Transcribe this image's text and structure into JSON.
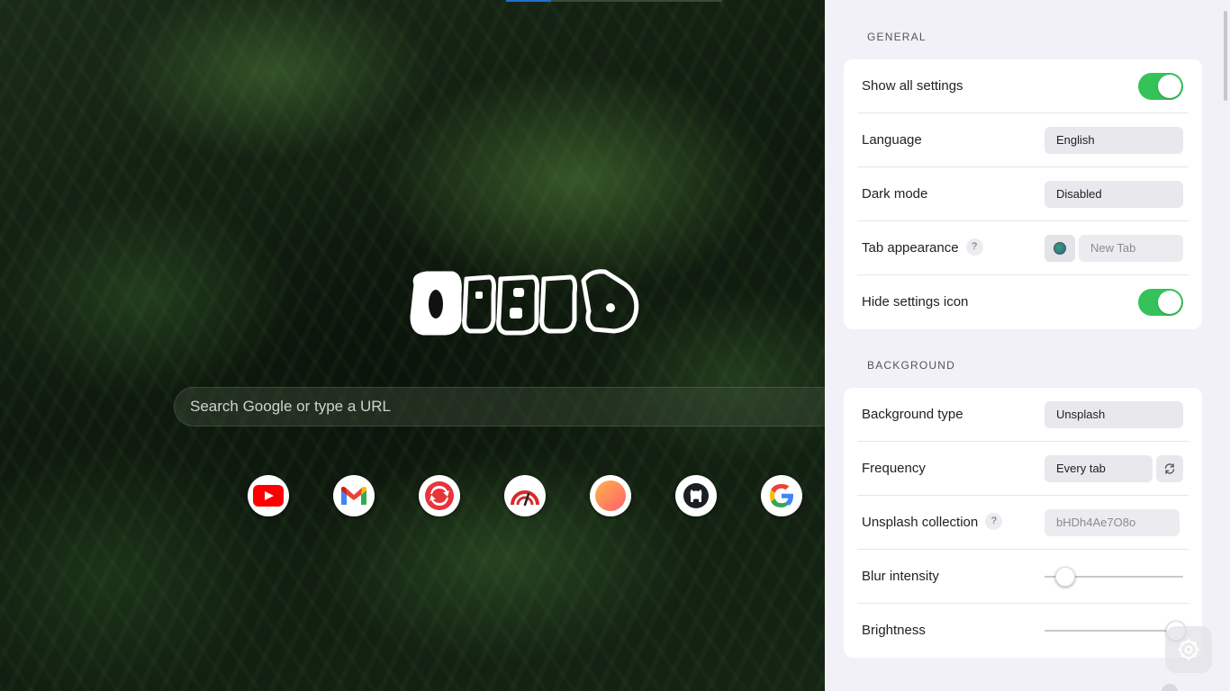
{
  "search": {
    "placeholder": "Search Google or type a URL"
  },
  "logo": {
    "text": "Bonjourr"
  },
  "shortcuts": [
    {
      "name": "YouTube",
      "icon": "youtube-icon"
    },
    {
      "name": "Gmail",
      "icon": "gmail-icon"
    },
    {
      "name": "Sync",
      "icon": "sync-icon"
    },
    {
      "name": "Speedtest",
      "icon": "speedometer-icon"
    },
    {
      "name": "Gradient",
      "icon": "gradient-circle-icon"
    },
    {
      "name": "GitHub",
      "icon": "github-icon"
    },
    {
      "name": "Google",
      "icon": "google-icon"
    }
  ],
  "settings": {
    "general": {
      "title": "GENERAL",
      "show_all": {
        "label": "Show all settings",
        "on": true
      },
      "language": {
        "label": "Language",
        "value": "English"
      },
      "dark_mode": {
        "label": "Dark mode",
        "value": "Disabled"
      },
      "tab_appearance": {
        "label": "Tab appearance",
        "help": "?",
        "placeholder": "New Tab"
      },
      "hide_icon": {
        "label": "Hide settings icon",
        "on": true
      }
    },
    "background": {
      "title": "BACKGROUND",
      "type": {
        "label": "Background type",
        "value": "Unsplash"
      },
      "frequency": {
        "label": "Frequency",
        "value": "Every tab"
      },
      "collection": {
        "label": "Unsplash collection",
        "help": "?",
        "placeholder": "bHDh4Ae7O8o"
      },
      "blur": {
        "label": "Blur intensity",
        "level": 0.15
      },
      "brightness": {
        "label": "Brightness",
        "level": 0.95
      }
    }
  },
  "colors": {
    "toggle_on": "#36c25a",
    "panel_bg": "#f2f1f7"
  }
}
